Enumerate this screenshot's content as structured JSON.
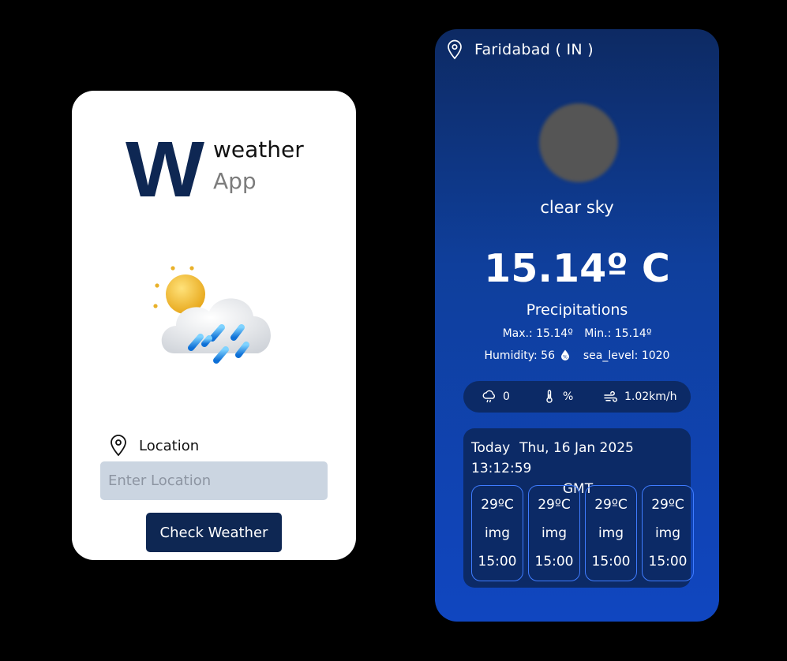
{
  "search_card": {
    "logo_letter": "W",
    "logo_line1": "weather",
    "logo_line2": "App",
    "location_label": "Location",
    "location_placeholder": "Enter Location",
    "check_button": "Check Weather"
  },
  "result": {
    "city": "Faridabad",
    "country": "( IN )",
    "description": "clear sky",
    "temperature": "15.14º C",
    "precip_title": "Precipitations",
    "max": "Max.: 15.14º",
    "min": "Min.: 15.14º",
    "humidity": "Humidity: 56",
    "sea_level": "sea_level: 1020",
    "stats": {
      "rain": "0",
      "temp_pct": "%",
      "wind": "1.02km/h"
    },
    "forecast": {
      "today_label": "Today",
      "date": "Thu, 16 Jan 2025 13:12:59",
      "tz": "GMT",
      "cards": [
        {
          "temp": "29ºC",
          "img": "img",
          "time": "15:00"
        },
        {
          "temp": "29ºC",
          "img": "img",
          "time": "15:00"
        },
        {
          "temp": "29ºC",
          "img": "img",
          "time": "15:00"
        },
        {
          "temp": "29ºC",
          "img": "img",
          "time": "15:00"
        }
      ]
    }
  },
  "colors": {
    "navy": "#0e2753",
    "input_bg": "#cbd5e1",
    "card_gradient_top": "#0d2a63",
    "card_gradient_bottom": "#1046c0",
    "forecast_border": "#3f7cff"
  }
}
